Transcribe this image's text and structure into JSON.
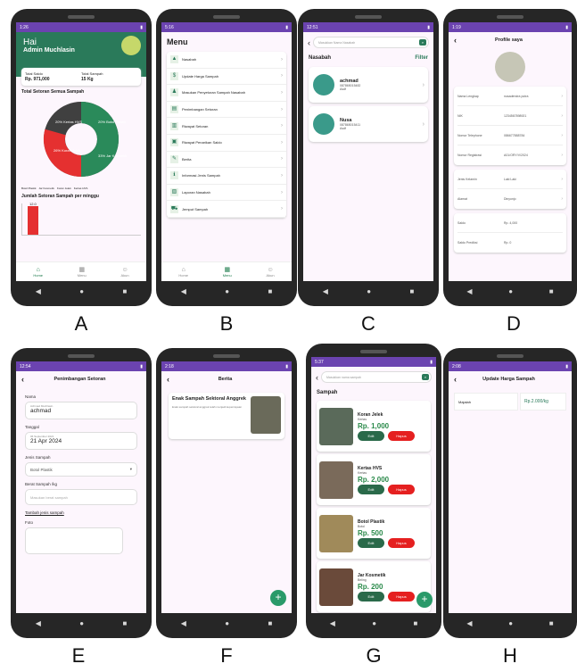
{
  "labels": [
    "A",
    "B",
    "C",
    "D",
    "E",
    "F",
    "G",
    "H"
  ],
  "times": {
    "a": "1:26",
    "b": "5:16",
    "c": "12:51",
    "d": "1:19",
    "e": "12:54",
    "f": "2:18",
    "g": "5:37",
    "h": "2:08"
  },
  "home": {
    "greeting": "Hai",
    "user": "Admin Muchlasin",
    "saldo_label": "Total Saldo",
    "saldo_value": "Rp. 971,000",
    "sampah_label": "Total Sampah",
    "sampah_value": "15 Kg",
    "donut_title": "Total Setoran Semua Sampah",
    "donut": [
      {
        "label": "20% Botol Plastik",
        "color": "#2a8a5a",
        "value": 20
      },
      {
        "label": "33% Jar Kosmetik",
        "color": "#2a8a5a",
        "value": 33
      },
      {
        "label": "26% Koran Jelek",
        "color": "#e53030",
        "value": 26
      },
      {
        "label": "20% Kertas HVS",
        "color": "#404040",
        "value": 20
      }
    ],
    "legend": [
      "Botol Plastik",
      "Jar Kosmetik",
      "Koran Jelek",
      "Kertas HVS"
    ],
    "bar_title": "Jumlah Setoran Sampah per minggu",
    "bar_value": "12.0",
    "nav": [
      "Home",
      "Menu",
      "Akun"
    ]
  },
  "menu": {
    "title": "Menu",
    "items": [
      "Nasabah",
      "Update Harga Sampah",
      "Masukan Penyetoran Sampah Nasabah",
      "Penimbangan Setoran",
      "Riwayat Setoran",
      "Riwayat Penarikan Saldo",
      "Berita",
      "Informasi Jenis Sampah",
      "Laporan Nasabah",
      "Jemput Sampah"
    ],
    "nav": [
      "Home",
      "Menu",
      "Akun"
    ]
  },
  "nasabah": {
    "search_placeholder": "Masukkan Nama Nasabah",
    "title": "Nasabah",
    "filter": "Filter",
    "list": [
      {
        "name": "achmad",
        "phone": "087865015482",
        "role": "Asdf"
      },
      {
        "name": "Nusa",
        "phone": "087865015411",
        "role": "Asdf"
      }
    ]
  },
  "profile": {
    "title": "Profile saya",
    "group1": [
      {
        "k": "Nama Lengkap",
        "v": "nusadendra putra"
      },
      {
        "k": "NIK",
        "v": "1234567898921"
      },
      {
        "k": "Nomor Telephone",
        "v": "086677888784"
      },
      {
        "k": "Nomor Registrasi",
        "v": "A01/ORY/V/2024"
      }
    ],
    "group2": [
      {
        "k": "Jenis Kelamin",
        "v": "Laki Laki"
      },
      {
        "k": "Alamat",
        "v": "Dinyonjo"
      }
    ],
    "group3": [
      {
        "k": "Saldo",
        "v": "Rp. 4,000"
      },
      {
        "k": "Saldo Prediksi",
        "v": "Rp. 0"
      }
    ]
  },
  "penimbangan": {
    "title": "Penimbangan Setoran",
    "nama_label": "Nama",
    "nama_hint": "Achmad Muchlasin",
    "nama_value": "achmad",
    "tanggal_label": "Tanggal",
    "tanggal_hint": "06 September 2021",
    "tanggal_value": "21 Apr 2024",
    "jenis_label": "Jenis Sampah",
    "jenis_value": "Botol Plastik",
    "berat_label": "Berat Sampah /kg",
    "berat_placeholder": "Masukan berat sampah",
    "tambah": "Tambah jenis sampah",
    "foto_label": "Foto"
  },
  "berita": {
    "title": "Berita",
    "news_title": "Enak Sampah Sektoral Anggrek",
    "news_desc": "Enak sampah sektoral anggrek telah menjadi kepercayaan"
  },
  "sampah": {
    "search_placeholder": "Masukkan nama sampah",
    "title": "Sampah",
    "edit": "Edit",
    "hapus": "Hapus",
    "list": [
      {
        "name": "Koran Jelek",
        "cat": "Kertas",
        "price": "Rp. 1,000",
        "color": "#5a6a5a"
      },
      {
        "name": "Kertas HVS",
        "cat": "Kertas",
        "price": "Rp. 2,000",
        "color": "#7a6a5a"
      },
      {
        "name": "Botol Plastik",
        "cat": "Botol",
        "price": "Rp. 500",
        "color": "#a08a5a"
      },
      {
        "name": "Jar Kosmetik",
        "cat": "Beling",
        "price": "Rp. 200",
        "color": "#6a4a3a"
      }
    ]
  },
  "harga": {
    "title": "Update Harga Sampah",
    "name": "Majalah",
    "price": "Rp.2.000/kg"
  }
}
